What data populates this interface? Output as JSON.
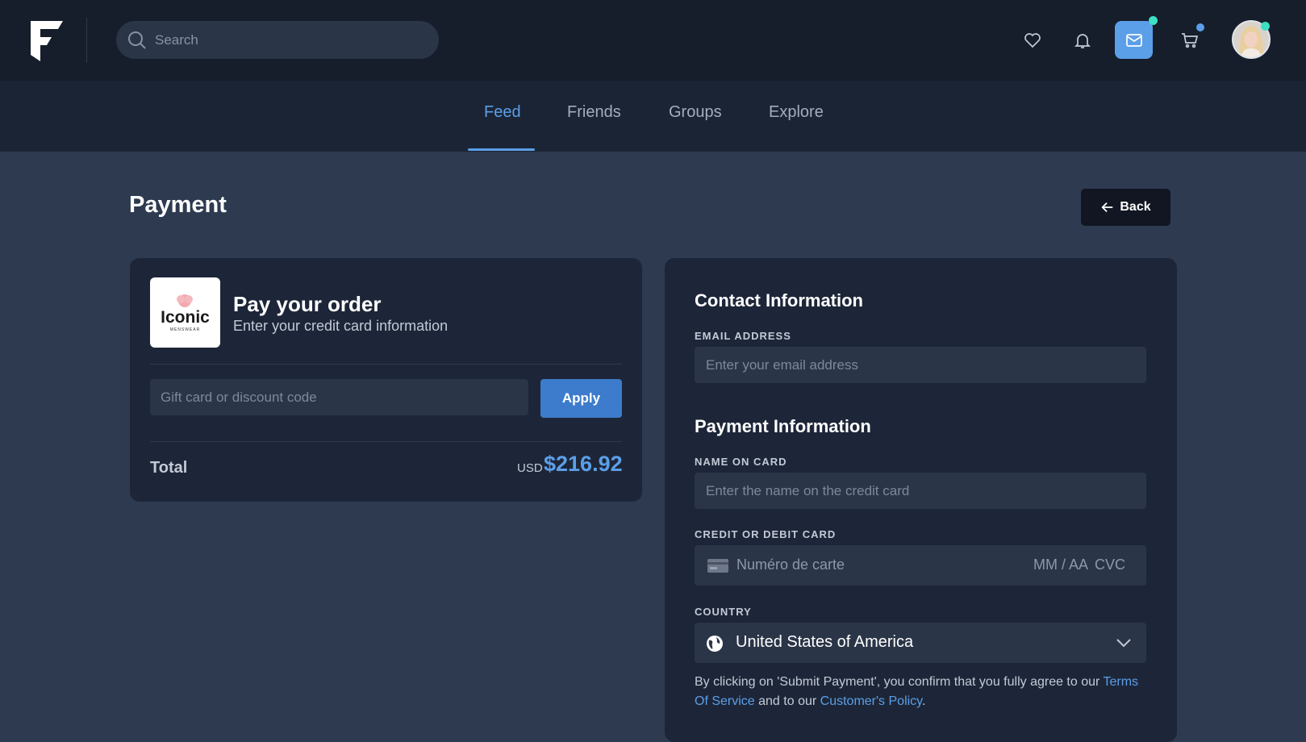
{
  "header": {
    "search_placeholder": "Search"
  },
  "nav": {
    "tabs": [
      {
        "label": "Feed",
        "active": true
      },
      {
        "label": "Friends",
        "active": false
      },
      {
        "label": "Groups",
        "active": false
      },
      {
        "label": "Explore",
        "active": false
      }
    ]
  },
  "page": {
    "title": "Payment",
    "back_label": "Back"
  },
  "order": {
    "brand_name": "Iconic",
    "brand_tagline": "MENSWEAR",
    "title": "Pay your order",
    "subtitle": "Enter your credit card information",
    "discount_placeholder": "Gift card or discount code",
    "apply_label": "Apply",
    "total_label": "Total",
    "currency": "USD",
    "amount": "$216.92"
  },
  "contact": {
    "title": "Contact Information",
    "email_label": "EMAIL ADDRESS",
    "email_placeholder": "Enter your email address"
  },
  "payment": {
    "title": "Payment Information",
    "name_label": "NAME ON CARD",
    "name_placeholder": "Enter the name on the credit card",
    "card_label": "CREDIT OR DEBIT CARD",
    "card_number_placeholder": "Numéro de carte",
    "card_expiry_placeholder": "MM / AA",
    "card_cvc_placeholder": "CVC",
    "country_label": "COUNTRY",
    "country_value": "United States of America",
    "terms_prefix": "By clicking on 'Submit Payment', you confirm that you fully agree to our ",
    "terms_link": "Terms Of Service",
    "terms_middle": " and to our ",
    "policy_link": "Customer's Policy",
    "terms_suffix": "."
  },
  "colors": {
    "accent": "#5b9fe8",
    "background": "#2d3a50",
    "card": "#1d2638",
    "topbar": "#161d2b",
    "online_dot": "#3ee0c3",
    "cart_dot": "#5b9fe8"
  }
}
